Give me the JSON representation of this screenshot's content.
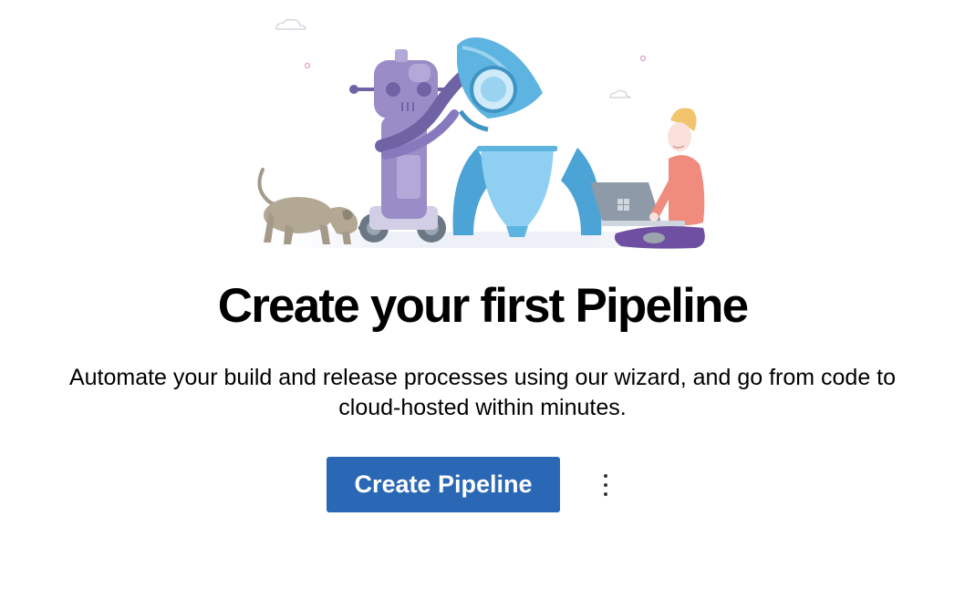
{
  "page": {
    "title": "Create your first Pipeline",
    "description": "Automate your build and release processes using our wizard, and go from code to cloud-hosted within minutes."
  },
  "actions": {
    "primary_label": "Create Pipeline",
    "more_icon": "more-vertical-icon"
  },
  "illustration": {
    "elements": [
      "cloud-icon",
      "robot",
      "rocket",
      "dog",
      "person-with-laptop"
    ]
  },
  "colors": {
    "primary_button": "#2a68b6",
    "robot": "#9a8dc7",
    "rocket": "#5eb4e1",
    "shirt": "#f08c7e"
  }
}
